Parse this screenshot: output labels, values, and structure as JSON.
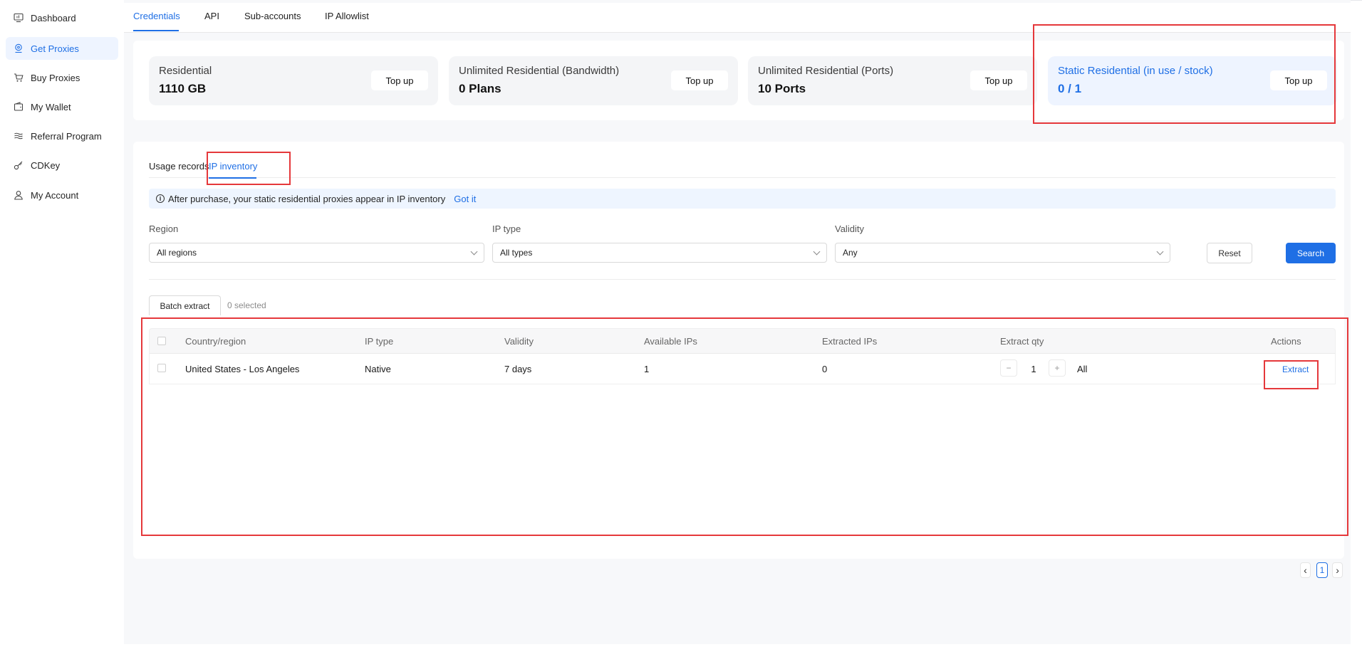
{
  "sidebar": {
    "items": [
      {
        "label": "Dashboard",
        "icon": "monitor-icon",
        "active": false
      },
      {
        "label": "Get Proxies",
        "icon": "location-pin-icon",
        "active": true
      },
      {
        "label": "Buy Proxies",
        "icon": "cart-icon",
        "active": false
      },
      {
        "label": "My Wallet",
        "icon": "wallet-icon",
        "active": false
      },
      {
        "label": "Referral Program",
        "icon": "layers-icon",
        "active": false
      },
      {
        "label": "CDKey",
        "icon": "key-icon",
        "active": false
      },
      {
        "label": "My Account",
        "icon": "user-icon",
        "active": false
      }
    ]
  },
  "top_tabs": [
    {
      "label": "Credentials",
      "active": true
    },
    {
      "label": "API",
      "active": false
    },
    {
      "label": "Sub-accounts",
      "active": false
    },
    {
      "label": "IP Allowlist",
      "active": false
    }
  ],
  "cards": [
    {
      "title": "Residential",
      "value": "1110 GB",
      "button": "Top up"
    },
    {
      "title": "Unlimited Residential (Bandwidth)",
      "value": "0 Plans",
      "button": "Top up"
    },
    {
      "title": "Unlimited Residential (Ports)",
      "value": "10 Ports",
      "button": "Top up"
    },
    {
      "title": "Static Residential (in use / stock)",
      "value": "0 / 1",
      "button": "Top up"
    }
  ],
  "sub_tabs": [
    {
      "label": "Usage records",
      "active": false
    },
    {
      "label": "IP inventory",
      "active": true
    }
  ],
  "notice": {
    "text": "After purchase, your static residential proxies appear in IP inventory",
    "action": "Got it"
  },
  "filters": {
    "region": {
      "label": "Region",
      "value": "All regions"
    },
    "ip_type": {
      "label": "IP type",
      "value": "All types"
    },
    "validity": {
      "label": "Validity",
      "value": "Any"
    },
    "reset": "Reset",
    "search": "Search"
  },
  "batch": {
    "button": "Batch extract",
    "selected": "0 selected"
  },
  "table": {
    "columns": [
      "Country/region",
      "IP type",
      "Validity",
      "Available IPs",
      "Extracted IPs",
      "Extract qty",
      "Actions"
    ],
    "rows": [
      {
        "country": "United States - Los Angeles",
        "ip_type": "Native",
        "validity": "7 days",
        "available": "1",
        "extracted": "0",
        "qty": "1",
        "qty_all": "All",
        "action": "Extract"
      }
    ]
  },
  "pagination": {
    "current": "1",
    "prev": "‹",
    "next": "›"
  },
  "colors": {
    "accent": "#1f6fe5",
    "annotation": "#e5383b"
  }
}
